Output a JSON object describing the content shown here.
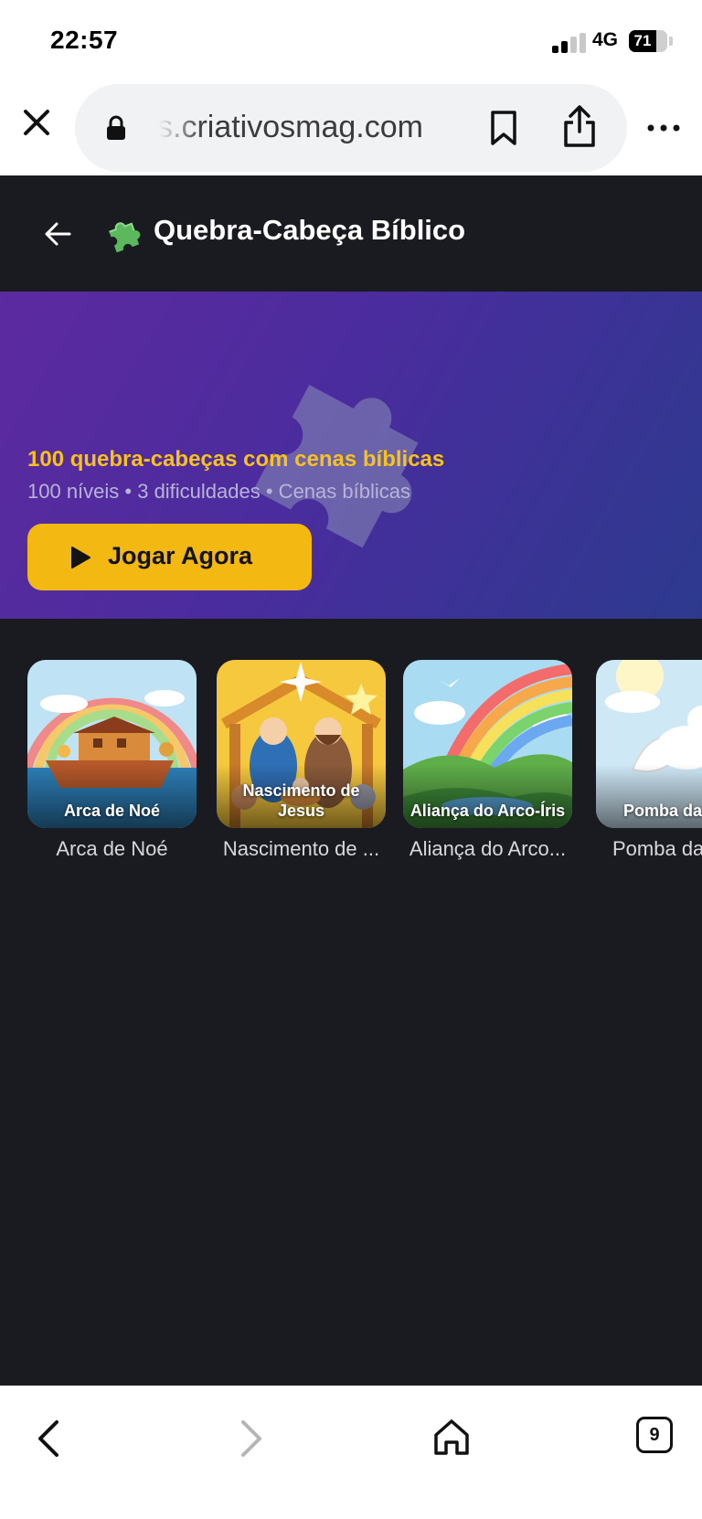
{
  "status_bar": {
    "time": "22:57",
    "network": "4G",
    "battery": "71",
    "battery_level": 0.71
  },
  "browser": {
    "url": "s.criativosmag.com",
    "icons": [
      "close-icon",
      "lock-icon",
      "bookmark-icon",
      "share-icon",
      "more-icon"
    ]
  },
  "header": {
    "title": "Quebra-Cabeça Bíblico",
    "icons": [
      "back-arrow-icon",
      "puzzle-icon"
    ]
  },
  "hero": {
    "subtitle": "100 quebra-cabeças com cenas bíblicas",
    "meta": "100 níveis • 3 dificuldades • Cenas bíblicas",
    "play_label": "Jogar Agora",
    "accent": "#f3b811"
  },
  "cards": [
    {
      "overlay": "Arca de Noé",
      "caption": "Arca de Noé"
    },
    {
      "overlay": "Nascimento de Jesus",
      "caption": "Nascimento de ..."
    },
    {
      "overlay": "Aliança do Arco-Íris",
      "caption": "Aliança do Arco..."
    },
    {
      "overlay": "Pomba da",
      "caption": "Pomba da"
    }
  ],
  "bottom_bar": {
    "tabs_count": "9",
    "icons": [
      "back-icon",
      "forward-icon",
      "home-icon",
      "tabs-icon"
    ]
  }
}
